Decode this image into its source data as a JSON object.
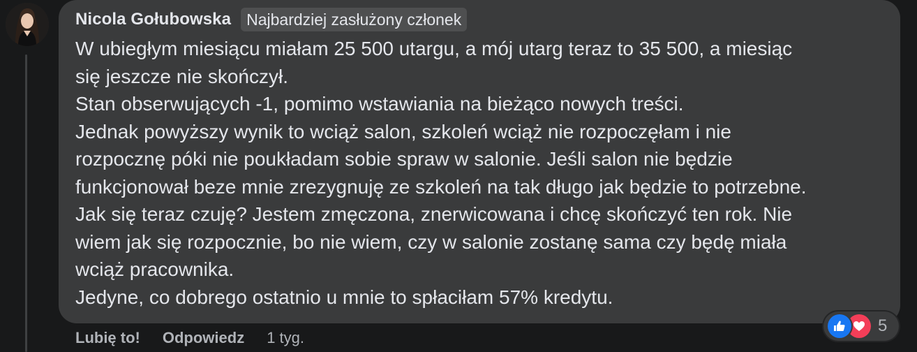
{
  "comment": {
    "author": "Nicola Gołubowska",
    "badge": "Najbardziej zasłużony członek",
    "lines": [
      "W ubiegłym miesiącu miałam 25 500 utargu, a mój utarg teraz to 35 500, a miesiąc",
      "się jeszcze nie skończył.",
      "Stan obserwujących -1, pomimo wstawiania na bieżąco nowych treści.",
      "Jednak powyższy wynik to wciąż salon, szkoleń wciąż nie rozpoczęłam i nie",
      "rozpocznę póki nie poukładam sobie spraw w salonie. Jeśli salon nie będzie",
      "funkcjonował beze mnie zrezygnuję ze szkoleń na tak długo jak będzie to potrzebne.",
      "Jak się teraz czuję? Jestem zmęczona, znerwicowana i chcę skończyć ten rok. Nie",
      "wiem jak się rozpocznie, bo nie wiem, czy w salonie zostanę sama czy będę miała",
      "wciąż pracownika.",
      "Jedyne, co dobrego ostatnio u mnie to spłaciłam 57% kredytu."
    ]
  },
  "actions": {
    "like": "Lubię to!",
    "reply": "Odpowiedz",
    "time": "1 tyg."
  },
  "reactions": {
    "icons": [
      "like-icon",
      "love-icon"
    ],
    "count": "5",
    "like_color": "#1877f2",
    "love_color": "#f33e58"
  },
  "colors": {
    "background": "#18191a",
    "bubble": "#3a3b3c",
    "text": "#e4e6eb",
    "secondary_text": "#b0b3b8"
  }
}
